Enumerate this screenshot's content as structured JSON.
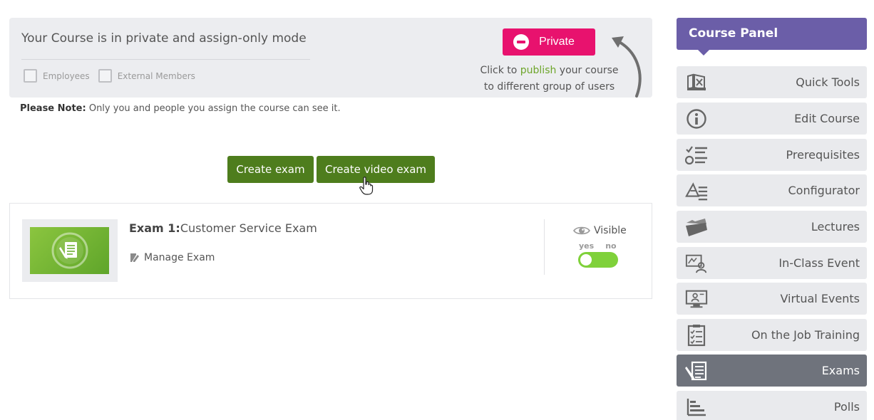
{
  "privacy": {
    "title": "Your Course is in private and assign-only mode",
    "checkboxes": [
      {
        "label": "Employees",
        "checked": false
      },
      {
        "label": "External Members",
        "checked": false
      }
    ],
    "private_button": "Private",
    "publish_prefix": "Click to ",
    "publish_link": "publish",
    "publish_suffix": " your course",
    "publish_line2": "to different group of users"
  },
  "note": {
    "bold": "Please Note:",
    "text": " Only you and people you assign the course can see it."
  },
  "actions": {
    "create_exam": "Create exam",
    "create_video_exam": "Create video exam"
  },
  "exam": {
    "number_label": "Exam 1:",
    "name": "Customer Service Exam",
    "manage_label": "Manage Exam",
    "visible_label": "Visible",
    "yes_label": "yes",
    "no_label": "no",
    "visible": true
  },
  "panel": {
    "title": "Course Panel",
    "items": [
      {
        "label": "Quick Tools",
        "icon": "quick-tools-icon",
        "active": false
      },
      {
        "label": "Edit Course",
        "icon": "info-icon",
        "active": false
      },
      {
        "label": "Prerequisites",
        "icon": "checklist-icon",
        "active": false
      },
      {
        "label": "Configurator",
        "icon": "configurator-icon",
        "active": false
      },
      {
        "label": "Lectures",
        "icon": "folder-icon",
        "active": false
      },
      {
        "label": "In-Class Event",
        "icon": "classroom-icon",
        "active": false
      },
      {
        "label": "Virtual Events",
        "icon": "monitor-icon",
        "active": false
      },
      {
        "label": "On the Job Training",
        "icon": "clipboard-icon",
        "active": false
      },
      {
        "label": "Exams",
        "icon": "exam-icon",
        "active": true
      },
      {
        "label": "Polls",
        "icon": "poll-icon",
        "active": false
      }
    ]
  },
  "colors": {
    "private_pink": "#e8126e",
    "green_button": "#4e7d1d",
    "panel_purple": "#6b5ea8",
    "active_item": "#6f737c",
    "toggle_green": "#7fd13a",
    "link_green": "#6da52a"
  }
}
